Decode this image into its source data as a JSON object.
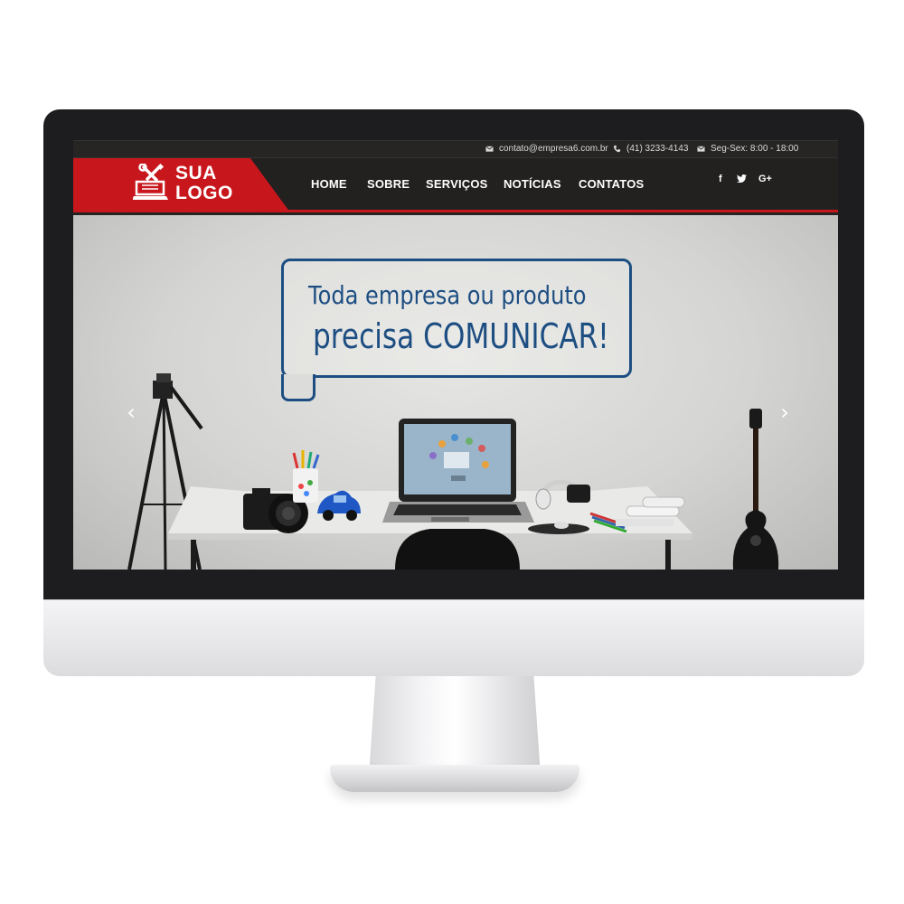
{
  "topbar": {
    "email": "contato@empresa6.com.br",
    "phone": "(41) 3233-4143",
    "hours": "Seg-Sex: 8:00 - 18:00"
  },
  "logo": {
    "line1": "SUA",
    "line2": "LOGO"
  },
  "nav": {
    "items": [
      {
        "label": "HOME"
      },
      {
        "label": "SOBRE"
      },
      {
        "label": "SERVIÇOS"
      },
      {
        "label": "NOTÍCIAS"
      },
      {
        "label": "CONTATOS"
      }
    ]
  },
  "social": {
    "facebook": "f",
    "twitter": "twitter-icon",
    "googleplus": "G+"
  },
  "hero": {
    "line1": "Toda empresa ou produto",
    "line2": "precisa COMUNICAR!",
    "prev": "‹",
    "next": "›"
  },
  "colors": {
    "brand_red": "#c8171c",
    "header_dark": "#222120",
    "headline_blue": "#1d4e82"
  }
}
